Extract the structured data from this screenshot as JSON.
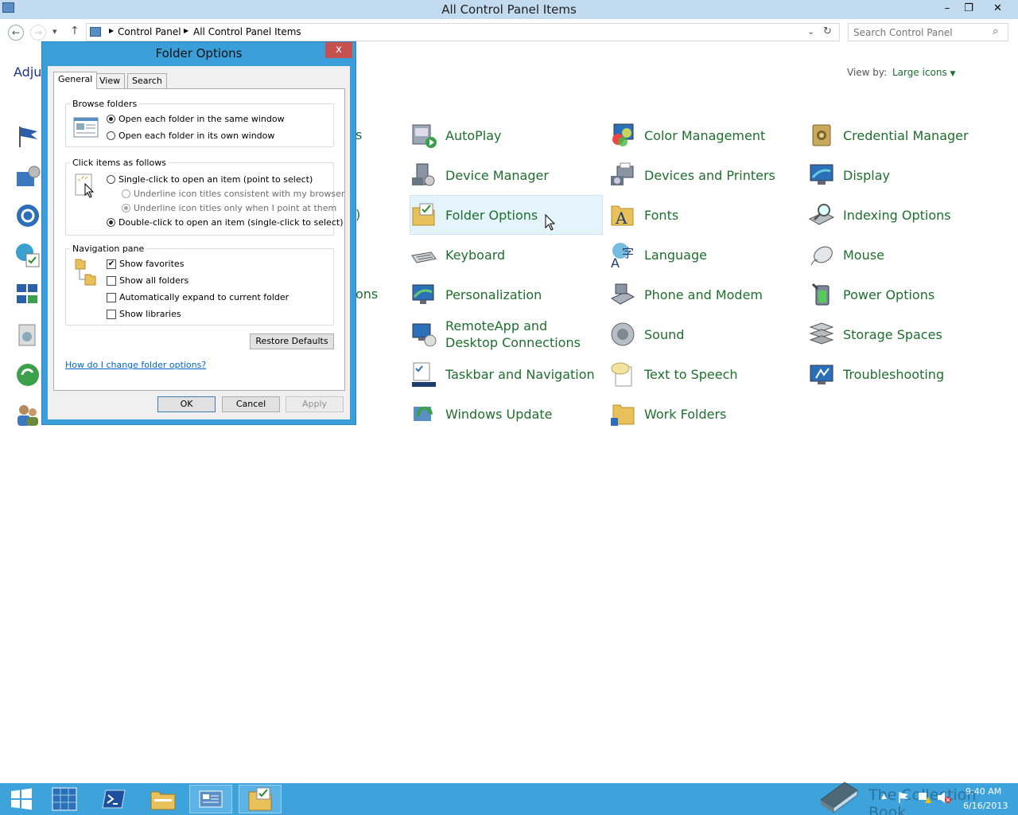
{
  "window": {
    "title": "All Control Panel Items",
    "minimize": "–",
    "restore": "❐",
    "close": "✕"
  },
  "nav": {
    "back": "←",
    "forward": "→",
    "recent": "▾",
    "up": "↑",
    "breadcrumb": [
      "Control Panel",
      "All Control Panel Items"
    ],
    "refresh": "↻",
    "search_placeholder": "Search Control Panel"
  },
  "main": {
    "heading_partial": "Adjus",
    "view_by_label": "View by:",
    "view_by_value": "Large icons",
    "partial_labels": [
      "s",
      ")",
      "ons"
    ],
    "items": [
      {
        "label": "AutoPlay",
        "icon": "autoplay-icon"
      },
      {
        "label": "Color Management",
        "icon": "color-management-icon"
      },
      {
        "label": "Credential Manager",
        "icon": "credential-manager-icon"
      },
      {
        "label": "Device Manager",
        "icon": "device-manager-icon"
      },
      {
        "label": "Devices and Printers",
        "icon": "devices-printers-icon"
      },
      {
        "label": "Display",
        "icon": "display-icon"
      },
      {
        "label": "Folder Options",
        "icon": "folder-options-icon"
      },
      {
        "label": "Fonts",
        "icon": "fonts-icon"
      },
      {
        "label": "Indexing Options",
        "icon": "indexing-options-icon"
      },
      {
        "label": "Keyboard",
        "icon": "keyboard-icon"
      },
      {
        "label": "Language",
        "icon": "language-icon"
      },
      {
        "label": "Mouse",
        "icon": "mouse-icon"
      },
      {
        "label": "Personalization",
        "icon": "personalization-icon"
      },
      {
        "label": "Phone and Modem",
        "icon": "phone-modem-icon"
      },
      {
        "label": "Power Options",
        "icon": "power-options-icon"
      },
      {
        "label": "RemoteApp and Desktop Connections",
        "icon": "remoteapp-icon"
      },
      {
        "label": "Sound",
        "icon": "sound-icon"
      },
      {
        "label": "Storage Spaces",
        "icon": "storage-spaces-icon"
      },
      {
        "label": "Taskbar and Navigation",
        "icon": "taskbar-navigation-icon"
      },
      {
        "label": "Text to Speech",
        "icon": "text-to-speech-icon"
      },
      {
        "label": "Troubleshooting",
        "icon": "troubleshooting-icon"
      },
      {
        "label": "Windows Update",
        "icon": "windows-update-icon"
      },
      {
        "label": "Work Folders",
        "icon": "work-folders-icon"
      }
    ]
  },
  "dialog": {
    "title": "Folder Options",
    "close": "x",
    "tabs": [
      "General",
      "View",
      "Search"
    ],
    "active_tab": "General",
    "browse": {
      "title": "Browse folders",
      "options": [
        "Open each folder in the same window",
        "Open each folder in its own window"
      ],
      "selected": 0
    },
    "click": {
      "title": "Click items as follows",
      "single": "Single-click to open an item (point to select)",
      "underline_browser": "Underline icon titles consistent with my browser",
      "underline_point": "Underline icon titles only when I point at them",
      "double": "Double-click to open an item (single-click to select)",
      "selected": "double"
    },
    "nav_pane": {
      "title": "Navigation pane",
      "options": [
        {
          "label": "Show favorites",
          "checked": true
        },
        {
          "label": "Show all folders",
          "checked": false
        },
        {
          "label": "Automatically expand to current folder",
          "checked": false
        },
        {
          "label": "Show libraries",
          "checked": false
        }
      ]
    },
    "restore_defaults": "Restore Defaults",
    "help_link": "How do I change folder options?",
    "ok": "OK",
    "cancel": "Cancel",
    "apply": "Apply"
  },
  "taskbar": {
    "time": "9:40 AM",
    "date": "6/16/2013",
    "watermark": "The Collection Book"
  },
  "colors": {
    "accent": "#3ea2db",
    "link": "#1e6e2e",
    "titlebar": "#c3dbee"
  }
}
